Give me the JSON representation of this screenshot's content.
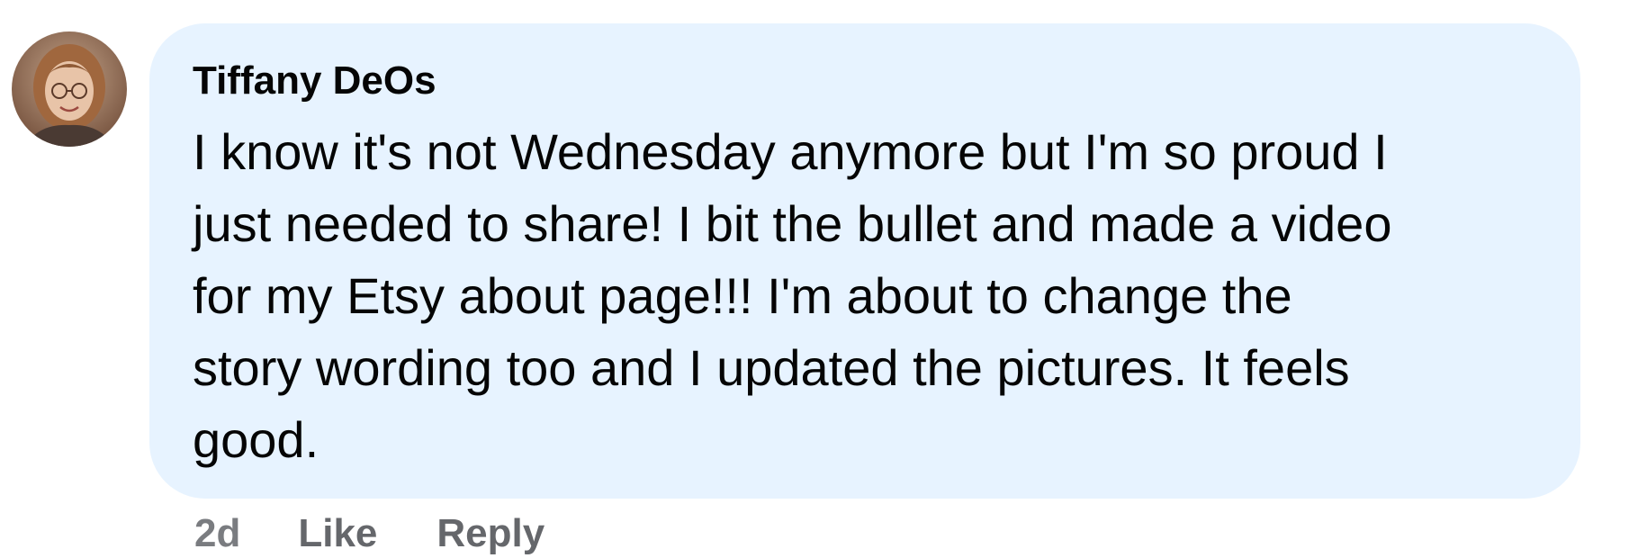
{
  "comment": {
    "author": "Tiffany DeOs",
    "avatar_icon": "user-profile-photo",
    "lines": [
      "I know it's not Wednesday anymore but I'm so proud I",
      "just needed to share! I bit the bullet and made a video",
      "for my Etsy about page!!! I'm about to change the",
      "story wording too and I updated the pictures. It feels",
      "good."
    ],
    "timestamp": "2d",
    "like_label": "Like",
    "reply_label": "Reply"
  },
  "colors": {
    "bubble_background": "#e7f3ff",
    "text": "#050505",
    "action_text": "#65676b"
  }
}
